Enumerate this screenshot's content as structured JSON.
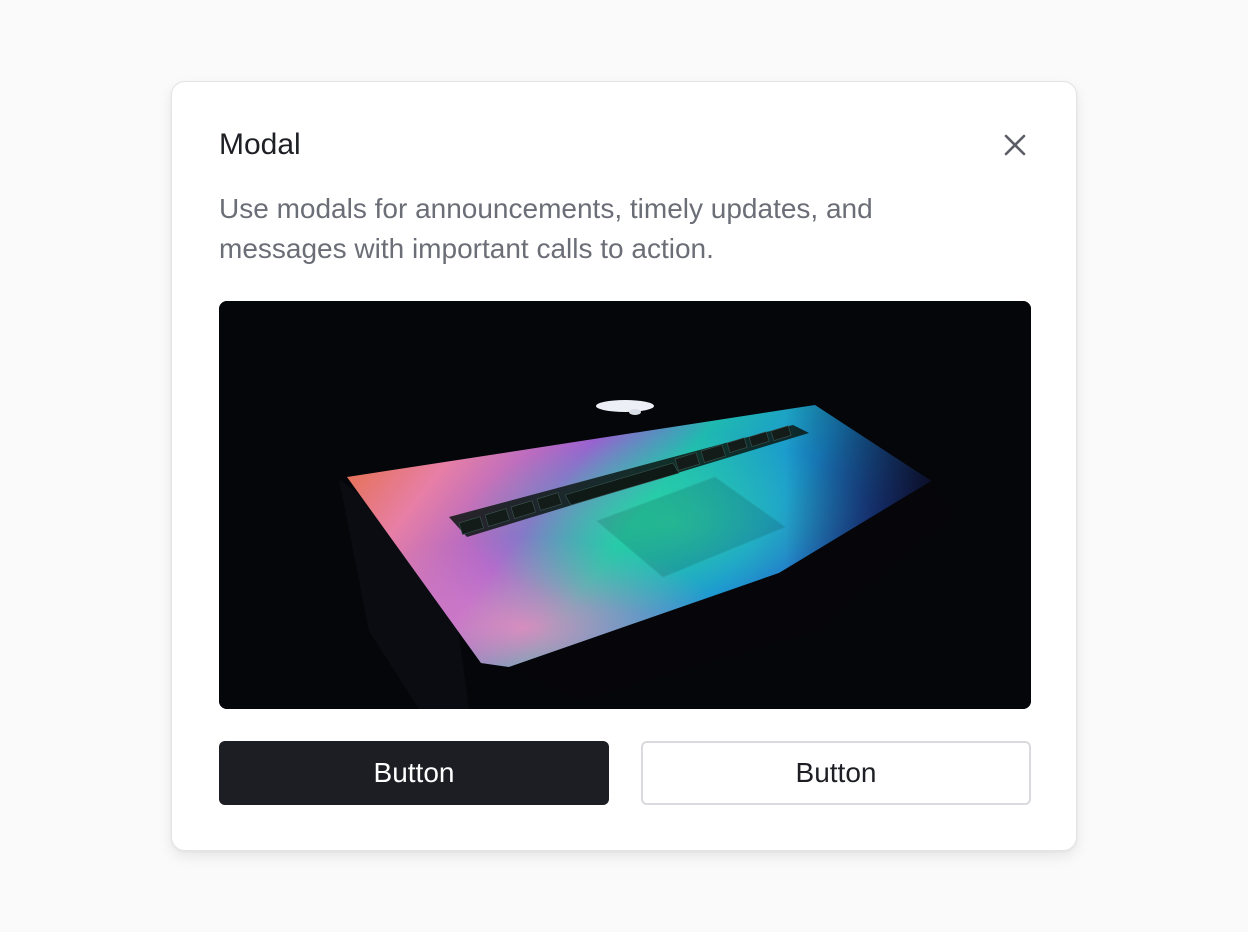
{
  "modal": {
    "title": "Modal",
    "description": "Use modals for announcements, timely updates, and messages with important calls to action.",
    "close_icon": "close-icon",
    "image": {
      "subject": "laptop-keyboard-gradient-image"
    },
    "primary_button_label": "Button",
    "secondary_button_label": "Button"
  },
  "colors": {
    "page_background": "#fafafa",
    "modal_background": "#ffffff",
    "primary_button": "#1c1e23",
    "title_text": "#1d1f24",
    "description_text": "#6b6e76"
  }
}
